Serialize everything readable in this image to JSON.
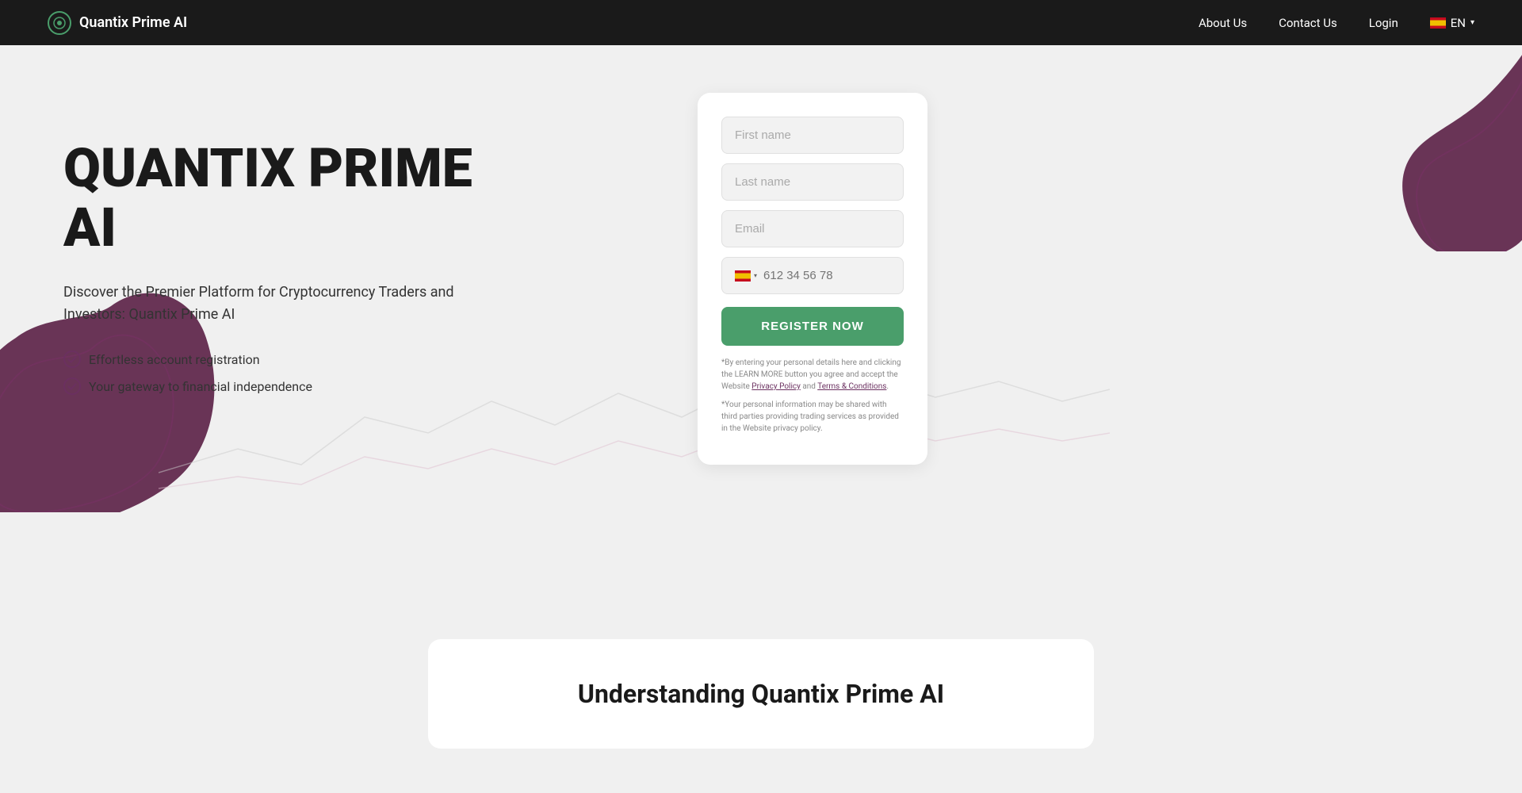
{
  "navbar": {
    "brand_name": "Quantix Prime AI",
    "links": [
      {
        "label": "About Us",
        "href": "#"
      },
      {
        "label": "Contact Us",
        "href": "#"
      },
      {
        "label": "Login",
        "href": "#"
      }
    ],
    "lang": "EN"
  },
  "hero": {
    "title_line1": "QUANTIX PRIME",
    "title_line2": "AI",
    "subtitle": "Discover the Premier Platform for Cryptocurrency Traders and Investors: Quantix Prime AI",
    "features": [
      "Effortless account registration",
      "Your gateway to financial independence"
    ]
  },
  "form": {
    "first_name_placeholder": "First name",
    "last_name_placeholder": "Last name",
    "email_placeholder": "Email",
    "phone_placeholder": "612 34 56 78",
    "register_button": "REGISTER NOW",
    "disclaimer1": "*By entering your personal details here and clicking the LEARN MORE button you agree and accept the Website ",
    "privacy_policy_link": "Privacy Policy",
    "and": " and ",
    "terms_link": "Terms & Conditions",
    "disclaimer1_end": ".",
    "disclaimer2": "*Your personal information may be shared with third parties providing trading services as provided in the Website privacy policy."
  },
  "understanding": {
    "title": "Understanding Quantix Prime AI"
  },
  "colors": {
    "dark": "#1a1a1a",
    "accent_purple": "#6b3060",
    "accent_green": "#4a9e6b",
    "bg_light": "#f0f0f0"
  }
}
